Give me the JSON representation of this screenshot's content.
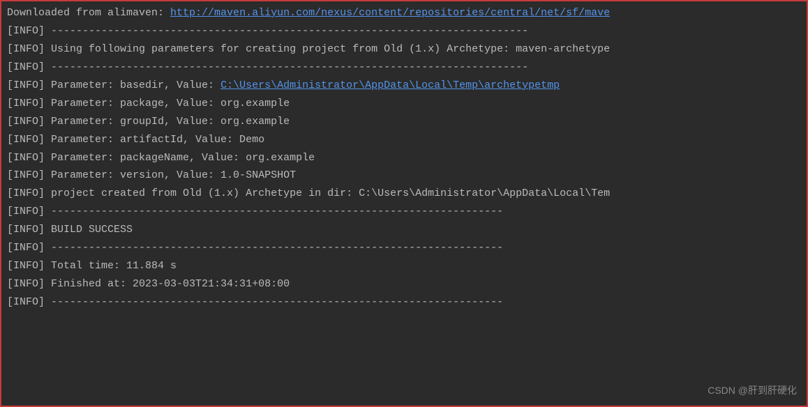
{
  "console": {
    "lines": [
      {
        "prefix": "Downloaded from alimaven: ",
        "link": "http://maven.aliyun.com/nexus/content/repositories/central/net/sf/mave",
        "tag": null,
        "text": null
      },
      {
        "tag": "[INFO]",
        "text": " ----------------------------------------------------------------------------"
      },
      {
        "tag": "[INFO]",
        "text": " Using following parameters for creating project from Old (1.x) Archetype: maven-archetype"
      },
      {
        "tag": "[INFO]",
        "text": " ----------------------------------------------------------------------------"
      },
      {
        "tag": "[INFO]",
        "text": " Parameter: basedir, Value: ",
        "link": "C:\\Users\\Administrator\\AppData\\Local\\Temp\\archetypetmp"
      },
      {
        "tag": "[INFO]",
        "text": " Parameter: package, Value: org.example"
      },
      {
        "tag": "[INFO]",
        "text": " Parameter: groupId, Value: org.example"
      },
      {
        "tag": "[INFO]",
        "text": " Parameter: artifactId, Value: Demo"
      },
      {
        "tag": "[INFO]",
        "text": " Parameter: packageName, Value: org.example"
      },
      {
        "tag": "[INFO]",
        "text": " Parameter: version, Value: 1.0-SNAPSHOT"
      },
      {
        "tag": "[INFO]",
        "text": " project created from Old (1.x) Archetype in dir: C:\\Users\\Administrator\\AppData\\Local\\Tem"
      },
      {
        "tag": "[INFO]",
        "text": " ------------------------------------------------------------------------"
      },
      {
        "tag": "[INFO]",
        "text": " BUILD SUCCESS"
      },
      {
        "tag": "[INFO]",
        "text": " ------------------------------------------------------------------------"
      },
      {
        "tag": "[INFO]",
        "text": " Total time:  11.884 s"
      },
      {
        "tag": "[INFO]",
        "text": " Finished at: 2023-03-03T21:34:31+08:00"
      },
      {
        "tag": "[INFO]",
        "text": " ------------------------------------------------------------------------"
      }
    ]
  },
  "watermark": "CSDN @肝到肝硬化"
}
